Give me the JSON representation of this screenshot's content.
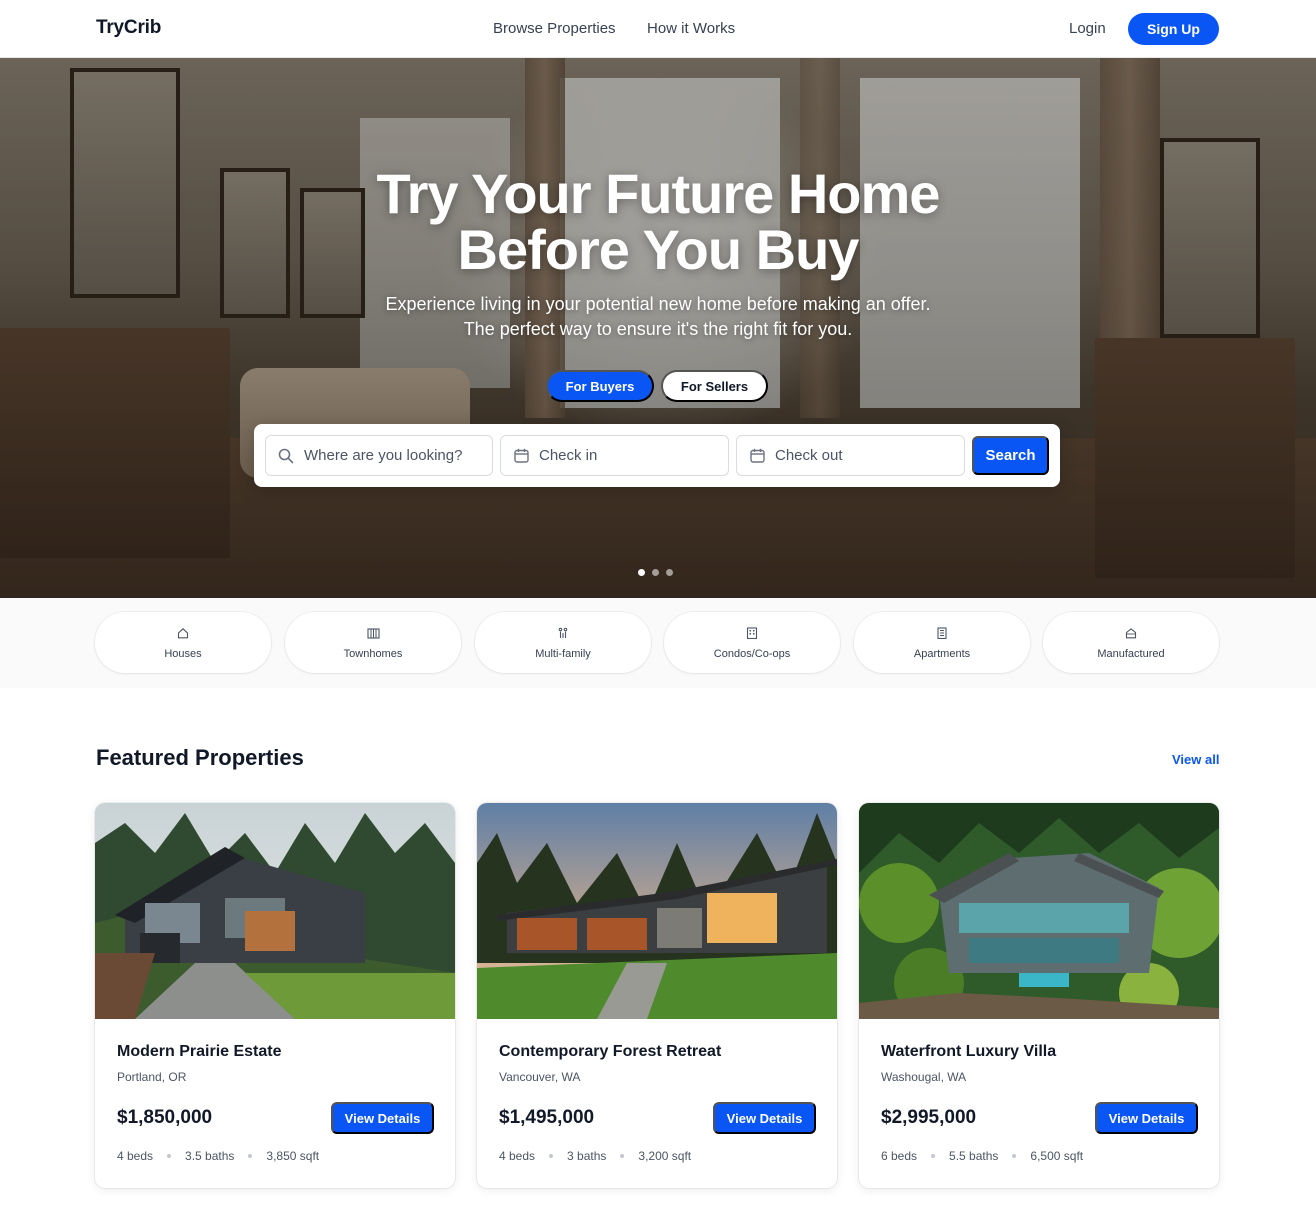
{
  "header": {
    "logo": "TryCrib",
    "nav": [
      "Browse Properties",
      "How it Works"
    ],
    "login": "Login",
    "signup": "Sign Up"
  },
  "hero": {
    "title_line1": "Try Your Future Home",
    "title_line2": "Before You Buy",
    "subtitle_line1": "Experience living in your potential new home before making an offer.",
    "subtitle_line2": "The perfect way to ensure it's the right fit for you.",
    "toggle_buyers": "For Buyers",
    "toggle_sellers": "For Sellers",
    "active_toggle": "For Buyers",
    "search": {
      "location_placeholder": "Where are you looking?",
      "checkin_placeholder": "Check in",
      "checkout_placeholder": "Check out",
      "button": "Search"
    },
    "carousel": {
      "count": 3,
      "active_index": 0
    }
  },
  "categories": [
    {
      "label": "Houses",
      "icon": "house-icon"
    },
    {
      "label": "Townhomes",
      "icon": "townhome-icon"
    },
    {
      "label": "Multi-family",
      "icon": "multi-family-icon"
    },
    {
      "label": "Condos/Co-ops",
      "icon": "condo-icon"
    },
    {
      "label": "Apartments",
      "icon": "apartment-icon"
    },
    {
      "label": "Manufactured",
      "icon": "manufactured-home-icon"
    }
  ],
  "featured": {
    "title": "Featured Properties",
    "view_all": "View all",
    "properties": [
      {
        "name": "Modern Prairie Estate",
        "location": "Portland, OR",
        "price": "$1,850,000",
        "button": "View Details",
        "beds": "4 beds",
        "baths": "3.5 baths",
        "sqft": "3,850 sqft"
      },
      {
        "name": "Contemporary Forest Retreat",
        "location": "Vancouver, WA",
        "price": "$1,495,000",
        "button": "View Details",
        "beds": "4 beds",
        "baths": "3 baths",
        "sqft": "3,200 sqft"
      },
      {
        "name": "Waterfront Luxury Villa",
        "location": "Washougal, WA",
        "price": "$2,995,000",
        "button": "View Details",
        "beds": "6 beds",
        "baths": "5.5 baths",
        "sqft": "6,500 sqft"
      }
    ]
  },
  "colors": {
    "accent": "#0a56f5",
    "text": "#111827",
    "muted": "#4b5563"
  }
}
